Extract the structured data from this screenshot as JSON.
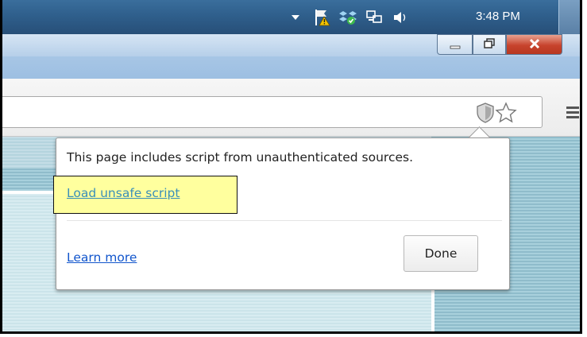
{
  "taskbar": {
    "clock": "3:48 PM",
    "tray_icons": [
      "chevron-down-icon",
      "action-center-flag-icon",
      "dropbox-icon",
      "network-icon",
      "volume-icon"
    ]
  },
  "window": {
    "buttons": [
      "minimize-icon",
      "maximize-icon",
      "close-icon"
    ]
  },
  "toolbar": {
    "icons": [
      "shield-icon",
      "star-icon",
      "menu-icon"
    ]
  },
  "bubble": {
    "message": "This page includes script from unauthenticated sources.",
    "load_unsafe_label": "Load unsafe script",
    "learn_more_label": "Learn more",
    "done_label": "Done"
  },
  "colors": {
    "highlight": "#ffff9e",
    "link": "#1155cc",
    "close_button": "#c7432d"
  }
}
